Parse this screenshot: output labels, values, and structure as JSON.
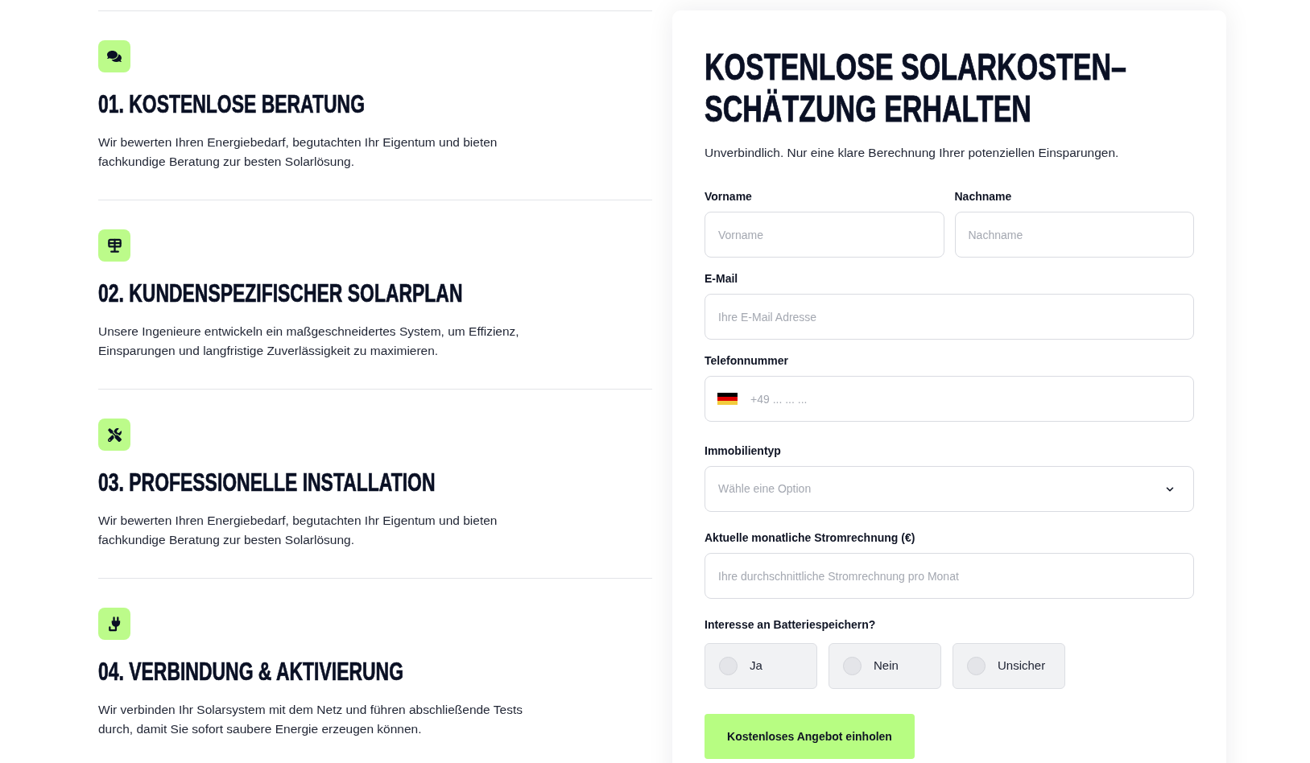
{
  "steps": [
    {
      "title": "01. KOSTENLOSE BERATUNG",
      "description": "Wir bewerten Ihren Energiebedarf, begutachten Ihr Eigentum und bieten fachkundige Beratung zur besten Solarlösung."
    },
    {
      "title": "02. KUNDENSPEZIFISCHER SOLARPLAN",
      "description": "Unsere Ingenieure entwickeln ein maßgeschneidertes System, um Effizienz, Einsparungen und langfristige Zuverlässigkeit zu maximieren."
    },
    {
      "title": "03. PROFESSIONELLE INSTALLATION",
      "description": "Wir bewerten Ihren Energiebedarf, begutachten Ihr Eigentum und bieten fachkundige Beratung zur besten Solarlösung."
    },
    {
      "title": "04. VERBINDUNG & AKTIVIERUNG",
      "description": "Wir verbinden Ihr Solarsystem mit dem Netz und führen abschließende Tests durch, damit Sie sofort saubere Energie erzeugen können."
    }
  ],
  "quote_form": {
    "title": "KOSTENLOSE SOLARKOSTEN–SCHÄTZUNG ERHALTEN",
    "subtitle": "Unverbindlich. Nur eine klare Berechnung Ihrer potenziellen Einsparungen.",
    "name_fields": [
      {
        "label": "Vorname",
        "placeholder": "Vorname"
      },
      {
        "label": "Nachname",
        "placeholder": "Nachname"
      }
    ],
    "email": {
      "label": "E-Mail",
      "placeholder": "Ihre E-Mail Adresse"
    },
    "phone": {
      "label": "Telefonnummer",
      "placeholder": "+49 ... ... ..."
    },
    "property_type": {
      "label": "Immobilientyp",
      "placeholder": "Wähle eine Option"
    },
    "monthly_bill": {
      "label": "Aktuelle monatliche Stromrechnung (€)",
      "placeholder": "Ihre durchschnittliche Stromrechnung pro Monat"
    },
    "battery_interest": {
      "label": "Interesse an Batteriespeichern?",
      "options": [
        {
          "label": "Ja",
          "selected": false
        },
        {
          "label": "Nein",
          "selected": false
        },
        {
          "label": "Unsicher",
          "selected": false
        }
      ]
    },
    "submit_button": "Kostenloses Angebot einholen"
  }
}
